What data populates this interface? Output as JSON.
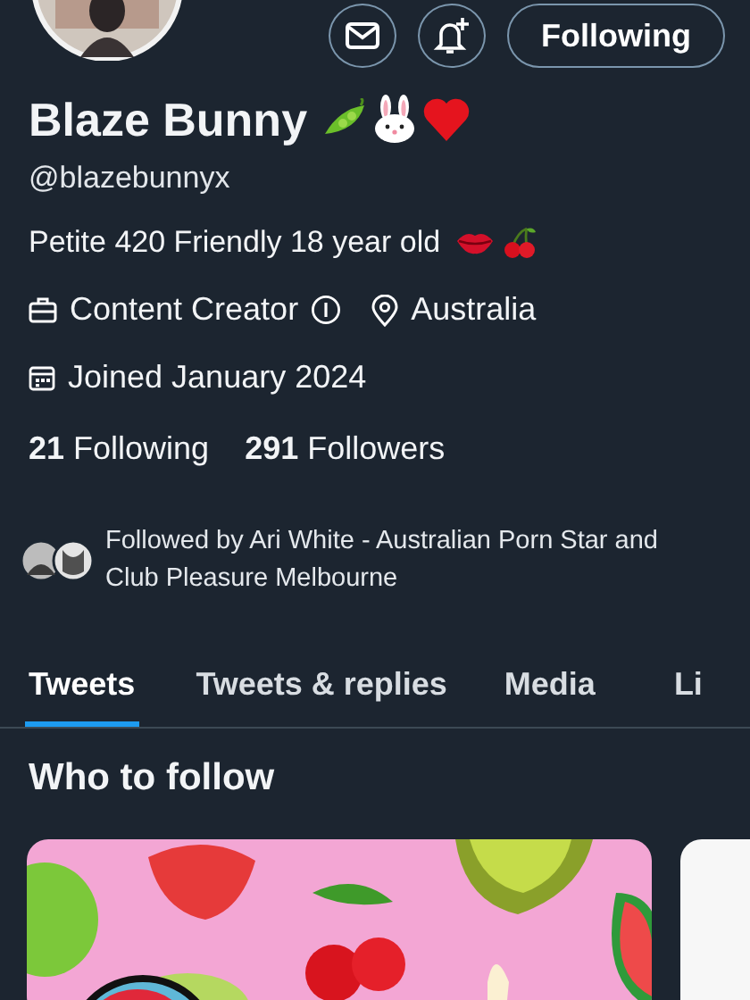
{
  "profile": {
    "name": "Blaze Bunny",
    "handle": "@blazebunnyx",
    "bio": "Petite 420 Friendly 18 year old",
    "category": "Content Creator",
    "location": "Australia",
    "joined": "Joined January 2024",
    "following_count": "21",
    "following_label": "Following",
    "followers_count": "291",
    "followers_label": "Followers",
    "followed_by": "Followed by Ari White - Australian Porn Star and Club Pleasure Melbourne"
  },
  "follow_button": "Following",
  "tabs": [
    {
      "label": "Tweets",
      "selected": true
    },
    {
      "label": "Tweets & replies",
      "selected": false
    },
    {
      "label": "Media",
      "selected": false
    },
    {
      "label": "Li",
      "selected": false
    }
  ],
  "who_to_follow": {
    "title": "Who to follow"
  }
}
